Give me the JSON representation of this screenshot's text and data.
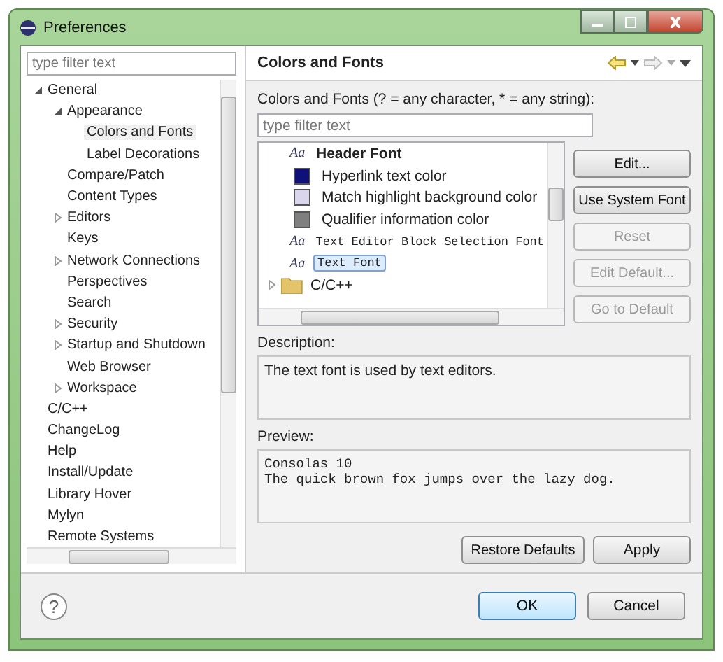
{
  "window": {
    "title": "Preferences"
  },
  "sidebar": {
    "filter": {
      "placeholder": "type filter text"
    },
    "items": [
      {
        "label": "General",
        "selected": false,
        "expanded": true,
        "children": [
          {
            "label": "Appearance",
            "selected": false,
            "expanded": true,
            "children": [
              {
                "label": "Colors and Fonts",
                "selected": true
              },
              {
                "label": "Label Decorations",
                "selected": false
              }
            ]
          },
          {
            "label": "Compare/Patch",
            "selected": false
          },
          {
            "label": "Content Types",
            "selected": false
          },
          {
            "label": "Editors",
            "selected": false,
            "expanded": false
          },
          {
            "label": "Keys",
            "selected": false
          },
          {
            "label": "Network Connections",
            "selected": false,
            "expanded": false
          },
          {
            "label": "Perspectives",
            "selected": false
          },
          {
            "label": "Search",
            "selected": false
          },
          {
            "label": "Security",
            "selected": false,
            "expanded": false
          },
          {
            "label": "Startup and Shutdown",
            "selected": false,
            "expanded": false
          },
          {
            "label": "Web Browser",
            "selected": false
          },
          {
            "label": "Workspace",
            "selected": false,
            "expanded": false
          }
        ]
      },
      {
        "label": "C/C++",
        "selected": false
      },
      {
        "label": "ChangeLog",
        "selected": false
      },
      {
        "label": "Help",
        "selected": false
      },
      {
        "label": "Install/Update",
        "selected": false
      },
      {
        "label": "Library Hover",
        "selected": false
      },
      {
        "label": "Mylyn",
        "selected": false
      },
      {
        "label": "Remote Systems",
        "selected": false
      }
    ]
  },
  "page": {
    "title": "Colors and Fonts",
    "filter_label": "Colors and Fonts (? = any character, * = any string):",
    "filter": {
      "placeholder": "type filter text"
    },
    "items": [
      {
        "kind": "heading",
        "icon": "Aa",
        "label": "Header Font",
        "selected": false
      },
      {
        "kind": "color",
        "label": "Hyperlink text color",
        "color": "#10107a",
        "selected": false
      },
      {
        "kind": "color",
        "label": "Match highlight background color",
        "color": "#d9d6ee",
        "selected": false
      },
      {
        "kind": "color",
        "label": "Qualifier information color",
        "color": "#7f7f7f",
        "selected": false
      },
      {
        "kind": "font",
        "icon": "Aa",
        "label": "Text Editor Block Selection Font",
        "selected": false
      },
      {
        "kind": "font",
        "icon": "Aa",
        "label": "Text Font",
        "selected": true
      },
      {
        "kind": "category",
        "label": "C/C++",
        "expanded": false,
        "selected": false
      }
    ],
    "buttons": [
      {
        "label": "Edit...",
        "disabled": false
      },
      {
        "label": "Use System Font",
        "disabled": false
      },
      {
        "label": "Reset",
        "disabled": true
      },
      {
        "label": "Edit Default...",
        "disabled": true
      },
      {
        "label": "Go to Default",
        "disabled": true
      }
    ],
    "description_label": "Description:",
    "description": "The text font is used by text editors.",
    "preview_label": "Preview:",
    "preview": [
      "Consolas 10",
      "The quick brown fox jumps over the lazy dog."
    ],
    "actions": [
      "Restore Defaults",
      "Apply"
    ]
  },
  "footer": {
    "help": "?",
    "buttons": [
      {
        "label": "OK",
        "default": true
      },
      {
        "label": "Cancel",
        "default": false
      }
    ]
  }
}
